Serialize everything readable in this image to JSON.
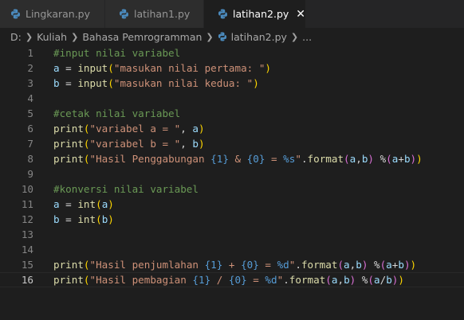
{
  "tabs": [
    {
      "label": "Lingkaran.py",
      "active": false
    },
    {
      "label": "latihan1.py",
      "active": false
    },
    {
      "label": "latihan2.py",
      "active": true,
      "close": "✕"
    }
  ],
  "breadcrumb": {
    "drive": "D:",
    "items": [
      "Kuliah",
      "Bahasa Pemrogramman"
    ],
    "file": "latihan2.py",
    "more": "..."
  },
  "colors": {
    "editor_bg": "#1e1e1e",
    "tabbar_bg": "#252526",
    "comment": "#6a9955",
    "function": "#dcdcaa",
    "variable": "#9cdcfe",
    "string": "#ce9178",
    "bracket_1": "#ffd700",
    "bracket_2": "#da70d6",
    "placeholder": "#569cd6",
    "python_icon": "#4b8bbe"
  },
  "editor": {
    "current_line": 16,
    "lines": [
      {
        "n": "1",
        "tokens": [
          [
            "cm",
            "#input nilai variabel"
          ]
        ]
      },
      {
        "n": "2",
        "tokens": [
          [
            "vr",
            "a"
          ],
          [
            "op",
            " = "
          ],
          [
            "fn",
            "input"
          ],
          [
            "p1",
            "("
          ],
          [
            "st",
            "\"masukan nilai pertama: \""
          ],
          [
            "p1",
            ")"
          ]
        ]
      },
      {
        "n": "3",
        "tokens": [
          [
            "vr",
            "b"
          ],
          [
            "op",
            " = "
          ],
          [
            "fn",
            "input"
          ],
          [
            "p1",
            "("
          ],
          [
            "st",
            "\"masukan nilai kedua: \""
          ],
          [
            "p1",
            ")"
          ]
        ]
      },
      {
        "n": "4",
        "tokens": []
      },
      {
        "n": "5",
        "tokens": [
          [
            "cm",
            "#cetak nilai variabel"
          ]
        ]
      },
      {
        "n": "6",
        "tokens": [
          [
            "fn",
            "print"
          ],
          [
            "p1",
            "("
          ],
          [
            "st",
            "\"variabel a = \""
          ],
          [
            "op",
            ", "
          ],
          [
            "vr",
            "a"
          ],
          [
            "p1",
            ")"
          ]
        ]
      },
      {
        "n": "7",
        "tokens": [
          [
            "fn",
            "print"
          ],
          [
            "p1",
            "("
          ],
          [
            "st",
            "\"variabel b = \""
          ],
          [
            "op",
            ", "
          ],
          [
            "vr",
            "b"
          ],
          [
            "p1",
            ")"
          ]
        ]
      },
      {
        "n": "8",
        "tokens": [
          [
            "fn",
            "print"
          ],
          [
            "p1",
            "("
          ],
          [
            "st",
            "\"Hasil Penggabungan "
          ],
          [
            "ph",
            "{1}"
          ],
          [
            "st",
            " & "
          ],
          [
            "ph",
            "{0}"
          ],
          [
            "st",
            " = "
          ],
          [
            "ph",
            "%s"
          ],
          [
            "st",
            "\""
          ],
          [
            "op",
            "."
          ],
          [
            "fn",
            "format"
          ],
          [
            "p2",
            "("
          ],
          [
            "vr",
            "a"
          ],
          [
            "op",
            ","
          ],
          [
            "vr",
            "b"
          ],
          [
            "p2",
            ")"
          ],
          [
            "op",
            " %"
          ],
          [
            "p2",
            "("
          ],
          [
            "vr",
            "a"
          ],
          [
            "op",
            "+"
          ],
          [
            "vr",
            "b"
          ],
          [
            "p2",
            ")"
          ],
          [
            "p1",
            ")"
          ]
        ]
      },
      {
        "n": "9",
        "tokens": []
      },
      {
        "n": "10",
        "tokens": [
          [
            "cm",
            "#konversi nilai variabel"
          ]
        ]
      },
      {
        "n": "11",
        "tokens": [
          [
            "vr",
            "a"
          ],
          [
            "op",
            " = "
          ],
          [
            "fn",
            "int"
          ],
          [
            "p1",
            "("
          ],
          [
            "vr",
            "a"
          ],
          [
            "p1",
            ")"
          ]
        ]
      },
      {
        "n": "12",
        "tokens": [
          [
            "vr",
            "b"
          ],
          [
            "op",
            " = "
          ],
          [
            "fn",
            "int"
          ],
          [
            "p1",
            "("
          ],
          [
            "vr",
            "b"
          ],
          [
            "p1",
            ")"
          ]
        ]
      },
      {
        "n": "13",
        "tokens": []
      },
      {
        "n": "14",
        "tokens": []
      },
      {
        "n": "15",
        "tokens": [
          [
            "fn",
            "print"
          ],
          [
            "p1",
            "("
          ],
          [
            "st",
            "\"Hasil penjumlahan "
          ],
          [
            "ph",
            "{1}"
          ],
          [
            "st",
            " + "
          ],
          [
            "ph",
            "{0}"
          ],
          [
            "st",
            " = "
          ],
          [
            "ph",
            "%d"
          ],
          [
            "st",
            "\""
          ],
          [
            "op",
            "."
          ],
          [
            "fn",
            "format"
          ],
          [
            "p2",
            "("
          ],
          [
            "vr",
            "a"
          ],
          [
            "op",
            ","
          ],
          [
            "vr",
            "b"
          ],
          [
            "p2",
            ")"
          ],
          [
            "op",
            " %"
          ],
          [
            "p2",
            "("
          ],
          [
            "vr",
            "a"
          ],
          [
            "op",
            "+"
          ],
          [
            "vr",
            "b"
          ],
          [
            "p2",
            ")"
          ],
          [
            "p1",
            ")"
          ]
        ]
      },
      {
        "n": "16",
        "tokens": [
          [
            "fn",
            "print"
          ],
          [
            "p1",
            "("
          ],
          [
            "st",
            "\"Hasil pembagian "
          ],
          [
            "ph",
            "{1}"
          ],
          [
            "st",
            " / "
          ],
          [
            "ph",
            "{0}"
          ],
          [
            "st",
            " = "
          ],
          [
            "ph",
            "%d"
          ],
          [
            "st",
            "\""
          ],
          [
            "op",
            "."
          ],
          [
            "fn",
            "format"
          ],
          [
            "p2",
            "("
          ],
          [
            "vr",
            "a"
          ],
          [
            "op",
            ","
          ],
          [
            "vr",
            "b"
          ],
          [
            "p2",
            ")"
          ],
          [
            "op",
            " %"
          ],
          [
            "p2",
            "("
          ],
          [
            "vr",
            "a"
          ],
          [
            "op",
            "/"
          ],
          [
            "vr",
            "b"
          ],
          [
            "p2",
            ")"
          ],
          [
            "p1",
            ")"
          ]
        ]
      }
    ]
  }
}
